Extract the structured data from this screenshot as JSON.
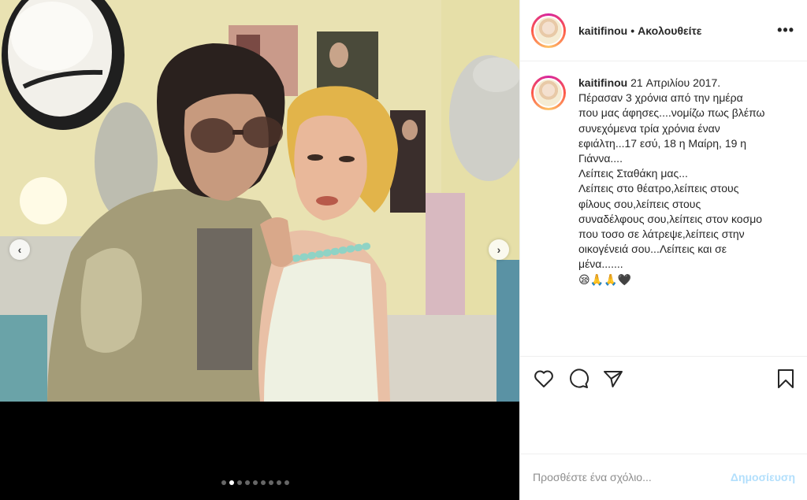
{
  "header": {
    "username": "kaitifinou",
    "separator": "•",
    "follow_label": "Ακολουθείτε",
    "more_icon": "more-options-icon"
  },
  "caption": {
    "username": "kaitifinou",
    "lines": [
      "21 Απριλίου 2017.",
      "Πέρασαν 3 χρόνια από την ημέρα",
      "που μας άφησες....νομίζω πως βλέπω",
      "συνεχόμενα τρία χρόνια έναν",
      "εφιάλτη...17 εσύ, 18 η Μαίρη, 19 η",
      "Γιάννα....",
      "Λείπεις Σταθάκη μας...",
      "Λείπεις στο θέατρο,λείπεις στους",
      "φίλους σου,λείπεις στους",
      "συναδέλφους σου,λείπεις στον κοσμο",
      "που τοσο σε λάτρεψε,λείπεις στην",
      "οικογένειά σου...Λείπεις και σε",
      "μένα.......",
      "😪🙏🙏🖤"
    ]
  },
  "media": {
    "prev_icon": "chevron-left-icon",
    "next_icon": "chevron-right-icon",
    "carousel_count": 9,
    "carousel_active_index": 1
  },
  "actions": {
    "like_icon": "heart-icon",
    "comment_icon": "comment-icon",
    "share_icon": "share-icon",
    "save_icon": "bookmark-icon"
  },
  "comment": {
    "placeholder": "Προσθέστε ένα σχόλιο...",
    "post_label": "Δημοσίευση"
  },
  "colors": {
    "post_disabled": "#b2dffc",
    "text": "#262626",
    "muted": "#8e8e8e"
  }
}
